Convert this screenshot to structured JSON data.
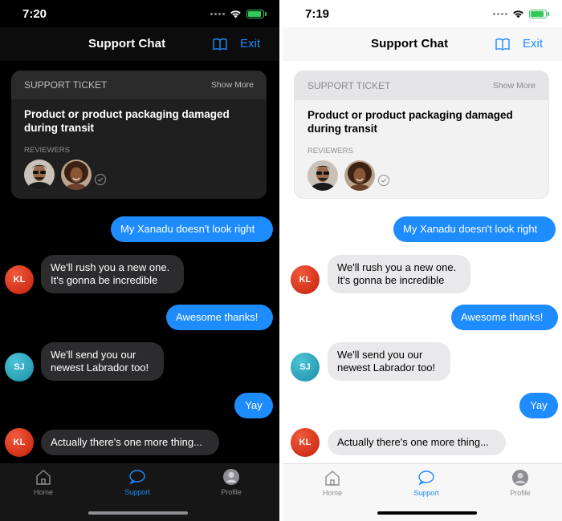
{
  "screens": {
    "dark": {
      "time": "7:20",
      "nav": {
        "title": "Support Chat",
        "exit_label": "Exit"
      },
      "ticket": {
        "header_label": "SUPPORT TICKET",
        "show_more": "Show More",
        "title": "Product or product packaging damaged during transit",
        "reviewers_label": "REVIEWERS"
      },
      "messages": [
        {
          "from": "me",
          "text": "My Xanadu doesn't look right"
        },
        {
          "from": "KL",
          "lines": [
            "We'll rush you a new one.",
            "It's gonna be incredible"
          ]
        },
        {
          "from": "me",
          "text": "Awesome thanks!"
        },
        {
          "from": "SJ",
          "lines": [
            "We'll send you our",
            "newest Labrador too!"
          ]
        },
        {
          "from": "me",
          "text": "Yay"
        },
        {
          "from": "KL",
          "text": "Actually there's one more thing..."
        }
      ],
      "tabs": [
        {
          "label": "Home",
          "icon": "house-icon"
        },
        {
          "label": "Support",
          "icon": "chat-bubble-icon",
          "active": true
        },
        {
          "label": "Profile",
          "icon": "person-icon"
        }
      ]
    },
    "light": {
      "time": "7:19",
      "nav": {
        "title": "Support Chat",
        "exit_label": "Exit"
      },
      "ticket": {
        "header_label": "SUPPORT TICKET",
        "show_more": "Show More",
        "title": "Product or product packaging damaged during transit",
        "reviewers_label": "REVIEWERS"
      },
      "messages": [
        {
          "from": "me",
          "text": "My Xanadu doesn't look right"
        },
        {
          "from": "KL",
          "lines": [
            "We'll rush you a new one.",
            "It's gonna be incredible"
          ]
        },
        {
          "from": "me",
          "text": "Awesome thanks!"
        },
        {
          "from": "SJ",
          "lines": [
            "We'll send you our",
            "newest Labrador too!"
          ]
        },
        {
          "from": "me",
          "text": "Yay"
        },
        {
          "from": "KL",
          "text": "Actually there's one more thing..."
        }
      ],
      "tabs": [
        {
          "label": "Home",
          "icon": "house-icon"
        },
        {
          "label": "Support",
          "icon": "chat-bubble-icon",
          "active": true
        },
        {
          "label": "Profile",
          "icon": "person-icon"
        }
      ]
    }
  },
  "avatars": {
    "KL": {
      "initials": "KL",
      "color": "#d9361a"
    },
    "SJ": {
      "initials": "SJ",
      "color": "#2aa5bd"
    }
  },
  "colors": {
    "accent": "#1e8cff",
    "dark_bg": "#000000",
    "light_bg": "#ffffff",
    "battery": "#34c759"
  }
}
